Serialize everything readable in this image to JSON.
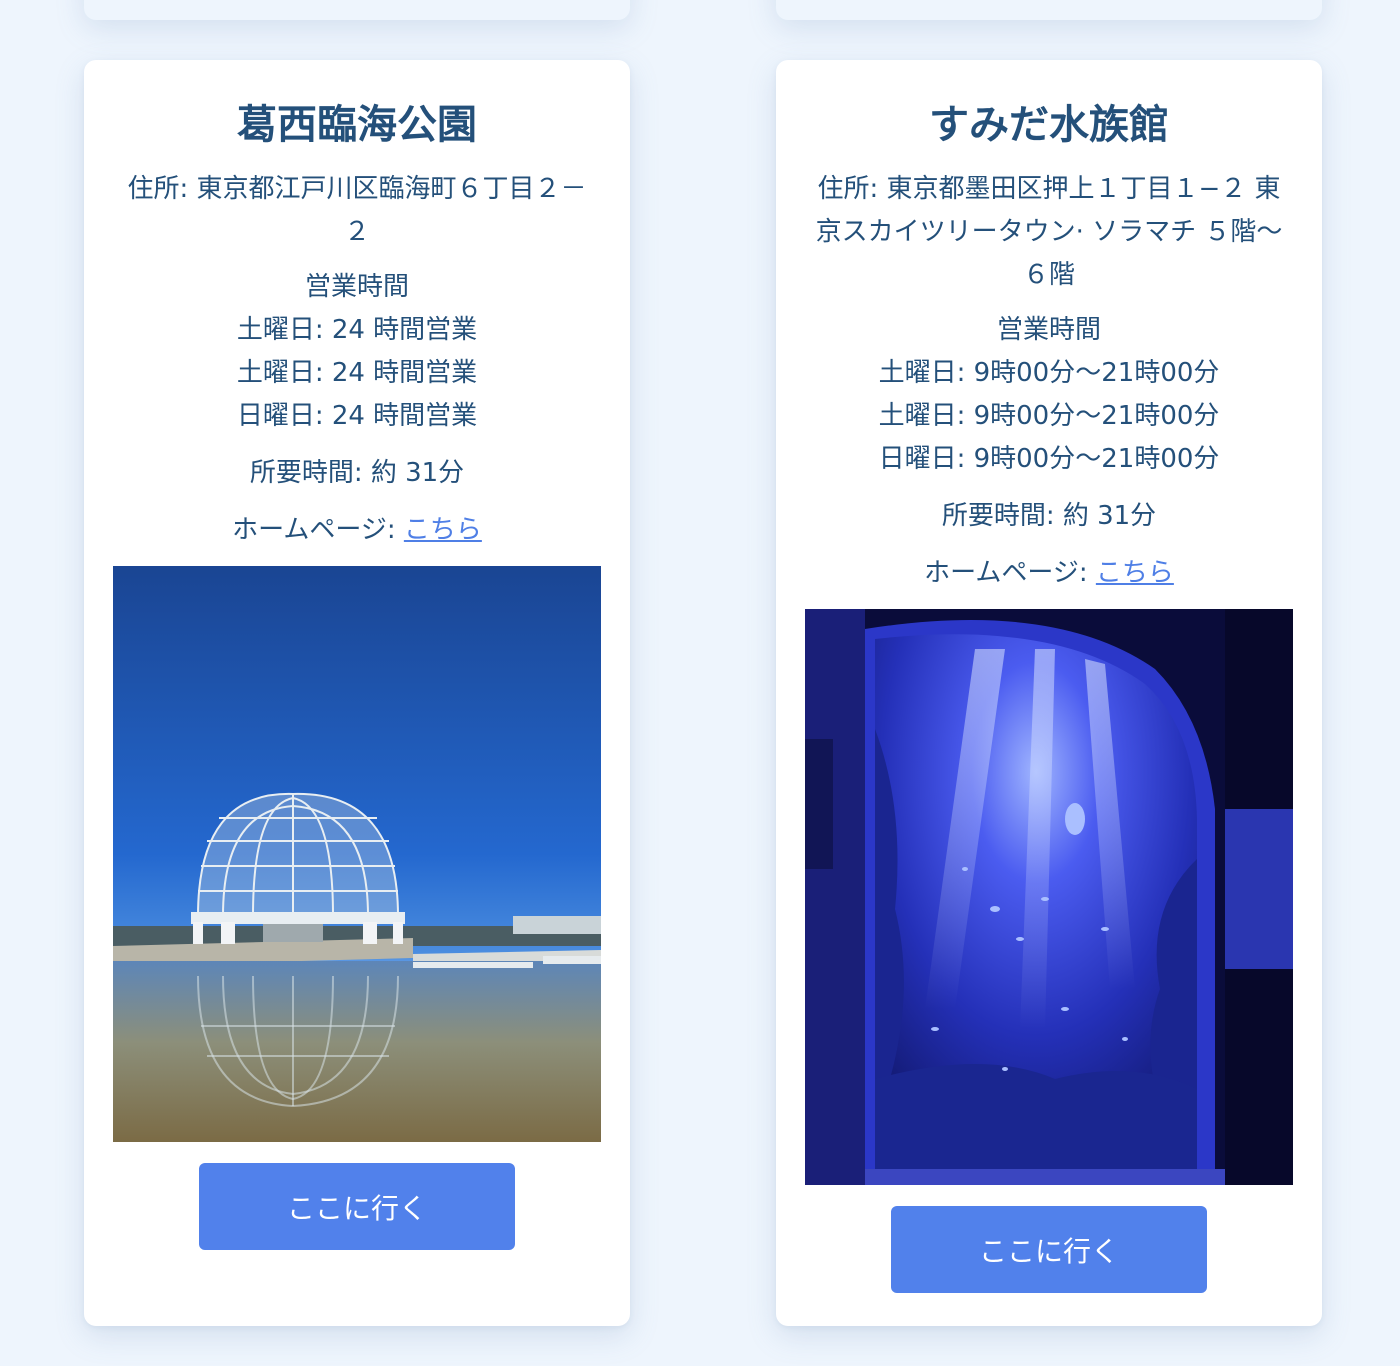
{
  "cards": [
    {
      "title": "葛西臨海公園",
      "address": "住所: 東京都江戸川区臨海町６丁目２－２",
      "hours_title": "営業時間",
      "hours": [
        "土曜日: 24 時間営業",
        "土曜日: 24 時間営業",
        "日曜日: 24 時間営業"
      ],
      "duration": "所要時間: 約 31分",
      "homepage_label": "ホームページ: ",
      "homepage_link": "こちら",
      "button_label": "ここに行く"
    },
    {
      "title": "すみだ水族館",
      "address": "住所: 東京都墨田区押上１丁目１−２ 東京スカイツリータウン· ソラマチ ５階～６階",
      "hours_title": "営業時間",
      "hours": [
        "土曜日: 9時00分～21時00分",
        "土曜日: 9時00分～21時00分",
        "日曜日: 9時00分～21時00分"
      ],
      "duration": "所要時間: 約 31分",
      "homepage_label": "ホームページ: ",
      "homepage_link": "こちら",
      "button_label": "ここに行く"
    }
  ],
  "colors": {
    "background": "#eef5fd",
    "text": "#24507a",
    "link": "#4f7fe6",
    "button": "#5181eb"
  }
}
